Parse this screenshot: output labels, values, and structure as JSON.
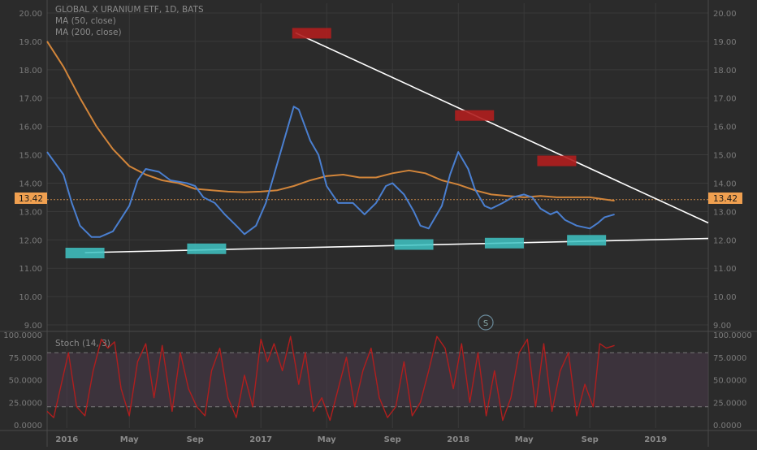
{
  "colors": {
    "background": "#2b2b2b",
    "grid": "#3a3a3a",
    "price": "#e08a3c",
    "ma50": "#4a7fd0",
    "ma200": "#d2853a",
    "trendline": "#ffffff",
    "resistance_box": "#b01e1e",
    "support_box": "#3fc4c4",
    "stoch": "#b01e1e",
    "stoch_band": "#4a3a4a",
    "last_price_tag": "#f0a050"
  },
  "legend": {
    "symbol": "GLOBAL X URANIUM ETF, 1D, BATS",
    "ma50": "MA (50, close)",
    "ma200": "MA (200, close)"
  },
  "stoch_label": "Stoch (14, 3)",
  "last_price": "13.42",
  "s_badge": "S",
  "chart_data": [
    {
      "type": "line",
      "title": "GLOBAL X URANIUM ETF, 1D, BATS",
      "y_ticks": [
        "9.00",
        "10.00",
        "11.00",
        "12.00",
        "13.00",
        "14.00",
        "15.00",
        "16.00",
        "17.00",
        "18.00",
        "19.00",
        "20.00"
      ],
      "ylim": [
        8.6,
        20.0
      ],
      "x_ticks": [
        "2016",
        "May",
        "Sep",
        "2017",
        "May",
        "Sep",
        "2018",
        "May",
        "Sep",
        "2019"
      ],
      "x_tick_pos": [
        1.2,
        5,
        9,
        13,
        17,
        21,
        25,
        29,
        33,
        37
      ],
      "xlim": [
        0,
        40.2
      ],
      "series": [
        {
          "name": "MA (50, close)",
          "x": [
            0,
            1,
            1.5,
            2,
            2.7,
            3.2,
            4,
            5,
            5.5,
            6,
            6.8,
            7.5,
            8.5,
            9,
            9.5,
            10.2,
            10.8,
            11.5,
            12,
            12.7,
            13.3,
            14,
            15,
            15.3,
            16,
            16.5,
            17,
            17.7,
            18.6,
            19.3,
            20,
            20.6,
            21,
            21.7,
            22.3,
            22.7,
            23.2,
            24,
            24.5,
            25,
            25.6,
            26,
            26.6,
            27,
            27.7,
            28.3,
            29,
            29.5,
            30,
            30.6,
            31,
            31.5,
            32.2,
            33,
            33.5,
            33.9,
            34.5
          ],
          "y": [
            15.1,
            14.3,
            13.3,
            12.5,
            12.1,
            12.1,
            12.3,
            13.2,
            14.1,
            14.5,
            14.4,
            14.1,
            14.0,
            13.9,
            13.5,
            13.3,
            12.9,
            12.5,
            12.2,
            12.5,
            13.3,
            14.7,
            16.7,
            16.6,
            15.5,
            15.0,
            13.9,
            13.3,
            13.3,
            12.9,
            13.3,
            13.9,
            14.0,
            13.6,
            13.0,
            12.5,
            12.4,
            13.2,
            14.3,
            15.1,
            14.5,
            13.8,
            13.2,
            13.1,
            13.3,
            13.5,
            13.6,
            13.5,
            13.1,
            12.9,
            13.0,
            12.7,
            12.5,
            12.4,
            12.6,
            12.8,
            12.9
          ]
        },
        {
          "name": "MA (200, close)",
          "x": [
            0,
            1,
            2,
            3,
            4,
            5,
            6,
            7,
            8,
            9,
            10,
            11,
            12,
            13,
            14,
            15,
            16,
            17,
            18,
            19,
            20,
            21,
            22,
            23,
            24,
            25,
            26,
            27,
            28,
            29,
            30,
            31,
            32,
            33,
            34,
            34.5
          ],
          "y": [
            19.0,
            18.1,
            17.0,
            16.0,
            15.2,
            14.6,
            14.3,
            14.1,
            14.0,
            13.8,
            13.75,
            13.7,
            13.68,
            13.7,
            13.75,
            13.9,
            14.1,
            14.25,
            14.3,
            14.2,
            14.2,
            14.35,
            14.45,
            14.35,
            14.1,
            13.95,
            13.75,
            13.6,
            13.55,
            13.5,
            13.55,
            13.5,
            13.5,
            13.5,
            13.42,
            13.38
          ]
        }
      ],
      "trendlines": [
        {
          "name": "resistance",
          "x": [
            15.1,
            40.2
          ],
          "y": [
            19.3,
            12.6
          ]
        },
        {
          "name": "support",
          "x": [
            2.3,
            40.2
          ],
          "y": [
            11.55,
            12.05
          ]
        }
      ],
      "resistance_boxes": [
        {
          "x": 15.1,
          "y": 19.3
        },
        {
          "x": 25.0,
          "y": 16.4
        },
        {
          "x": 30.0,
          "y": 14.8
        }
      ],
      "support_boxes": [
        {
          "x": 2.3,
          "y": 11.55
        },
        {
          "x": 9.7,
          "y": 11.7
        },
        {
          "x": 22.3,
          "y": 11.85
        },
        {
          "x": 27.8,
          "y": 11.9
        },
        {
          "x": 32.8,
          "y": 12.0
        }
      ]
    },
    {
      "type": "line",
      "title": "Stoch (14, 3)",
      "y_ticks": [
        "0.0000",
        "25.0000",
        "50.0000",
        "75.0000",
        "100.0000"
      ],
      "ylim": [
        0,
        100
      ],
      "bands": [
        20,
        80
      ],
      "series": [
        {
          "name": "Stoch (14, 3)",
          "x": [
            0,
            0.4,
            0.8,
            1.3,
            1.8,
            2.3,
            2.8,
            3.3,
            3.7,
            4.1,
            4.5,
            5.0,
            5.5,
            6.0,
            6.5,
            7.0,
            7.6,
            8.1,
            8.6,
            9.1,
            9.6,
            10.0,
            10.5,
            11.0,
            11.5,
            12.0,
            12.5,
            13.0,
            13.4,
            13.8,
            14.3,
            14.8,
            15.3,
            15.7,
            16.2,
            16.7,
            17.2,
            17.7,
            18.2,
            18.7,
            19.2,
            19.7,
            20.2,
            20.7,
            21.2,
            21.7,
            22.2,
            22.7,
            23.2,
            23.7,
            24.2,
            24.7,
            25.2,
            25.7,
            26.2,
            26.7,
            27.2,
            27.7,
            28.2,
            28.7,
            29.2,
            29.7,
            30.2,
            30.7,
            31.2,
            31.7,
            32.2,
            32.7,
            33.2,
            33.6,
            34.0,
            34.5
          ],
          "y": [
            15,
            8,
            40,
            80,
            20,
            10,
            60,
            95,
            85,
            92,
            40,
            10,
            70,
            90,
            30,
            88,
            15,
            80,
            40,
            20,
            10,
            60,
            85,
            30,
            8,
            55,
            20,
            95,
            70,
            90,
            60,
            98,
            45,
            80,
            15,
            30,
            5,
            40,
            75,
            20,
            60,
            85,
            30,
            8,
            20,
            70,
            10,
            25,
            60,
            98,
            85,
            40,
            90,
            25,
            80,
            10,
            60,
            5,
            30,
            80,
            95,
            20,
            90,
            15,
            60,
            80,
            10,
            45,
            20,
            90,
            85,
            88
          ]
        }
      ]
    }
  ]
}
